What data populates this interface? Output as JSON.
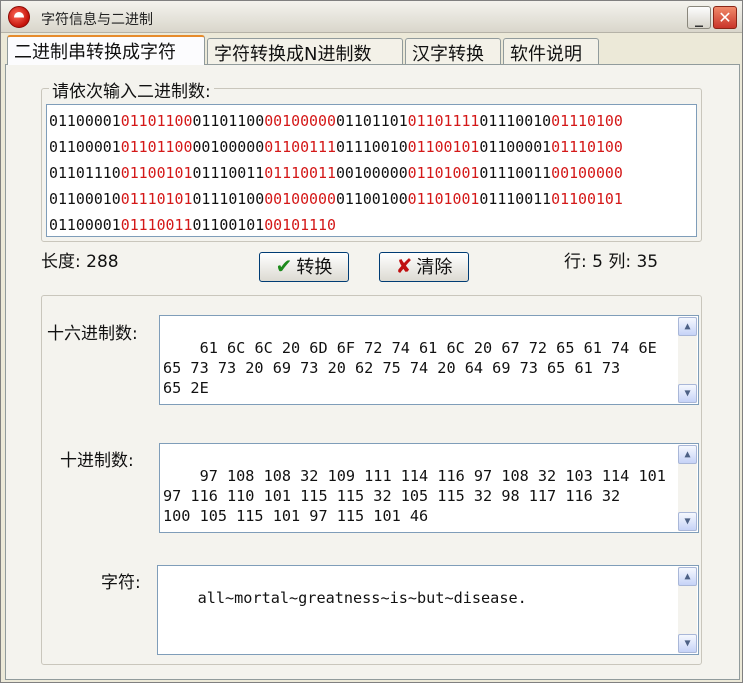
{
  "window": {
    "title": "字符信息与二进制",
    "minimize_glyph": "_",
    "close_glyph": "✕",
    "icon": "app-logo-icon"
  },
  "tabs": [
    {
      "label": "二进制串转换成字符",
      "active": true
    },
    {
      "label": "字符转换成N进制数",
      "active": false
    },
    {
      "label": "汉字转换",
      "active": false
    },
    {
      "label": "软件说明",
      "active": false
    }
  ],
  "binary_input": {
    "group_label": "请依次输入二进制数:",
    "lines": [
      [
        [
          "01100001",
          "b"
        ],
        [
          "01101100",
          "r"
        ],
        [
          "01101100",
          "b"
        ],
        [
          "00100000",
          "r"
        ],
        [
          "01101101",
          "b"
        ],
        [
          "01101111",
          "r"
        ],
        [
          "01110010",
          "b"
        ],
        [
          "01110100",
          "r"
        ]
      ],
      [
        [
          "01100001",
          "b"
        ],
        [
          "01101100",
          "r"
        ],
        [
          "00100000",
          "b"
        ],
        [
          "01100111",
          "r"
        ],
        [
          "01110010",
          "b"
        ],
        [
          "01100101",
          "r"
        ],
        [
          "01100001",
          "b"
        ],
        [
          "01110100",
          "r"
        ]
      ],
      [
        [
          "01101110",
          "b"
        ],
        [
          "01100101",
          "r"
        ],
        [
          "01110011",
          "b"
        ],
        [
          "01110011",
          "r"
        ],
        [
          "00100000",
          "b"
        ],
        [
          "01101001",
          "r"
        ],
        [
          "01110011",
          "b"
        ],
        [
          "00100000",
          "r"
        ]
      ],
      [
        [
          "01100010",
          "b"
        ],
        [
          "01110101",
          "r"
        ],
        [
          "01110100",
          "b"
        ],
        [
          "00100000",
          "r"
        ],
        [
          "01100100",
          "b"
        ],
        [
          "01101001",
          "r"
        ],
        [
          "01110011",
          "b"
        ],
        [
          "01100101",
          "r"
        ]
      ],
      [
        [
          "01100001",
          "b"
        ],
        [
          "01110011",
          "r"
        ],
        [
          "01100101",
          "b"
        ],
        [
          "00101110",
          "r"
        ]
      ]
    ],
    "colors": {
      "b": "#111111",
      "r": "#d41818"
    }
  },
  "status": {
    "length_text": "长度: 288",
    "row_col_text": "行: 5  列: 35"
  },
  "buttons": {
    "convert": {
      "icon": "✔",
      "label": "转换"
    },
    "clear": {
      "icon": "✘",
      "label": "清除"
    }
  },
  "outputs": {
    "hex": {
      "label": "十六进制数:",
      "value": "61 6C 6C 20 6D 6F 72 74 61 6C 20 67 72 65 61 74 6E\n65 73 73 20 69 73 20 62 75 74 20 64 69 73 65 61 73\n65 2E"
    },
    "decimal": {
      "label": "十进制数:",
      "value": "97 108 108 32 109 111 114 116 97 108 32 103 114 101\n97 116 110 101 115 115 32 105 115 32 98 117 116 32\n100 105 115 101 97 115 101 46"
    },
    "chars": {
      "label": "字符:",
      "value": "all~mortal~greatness~is~but~disease."
    }
  },
  "scroll": {
    "up": "▲",
    "down": "▼"
  }
}
